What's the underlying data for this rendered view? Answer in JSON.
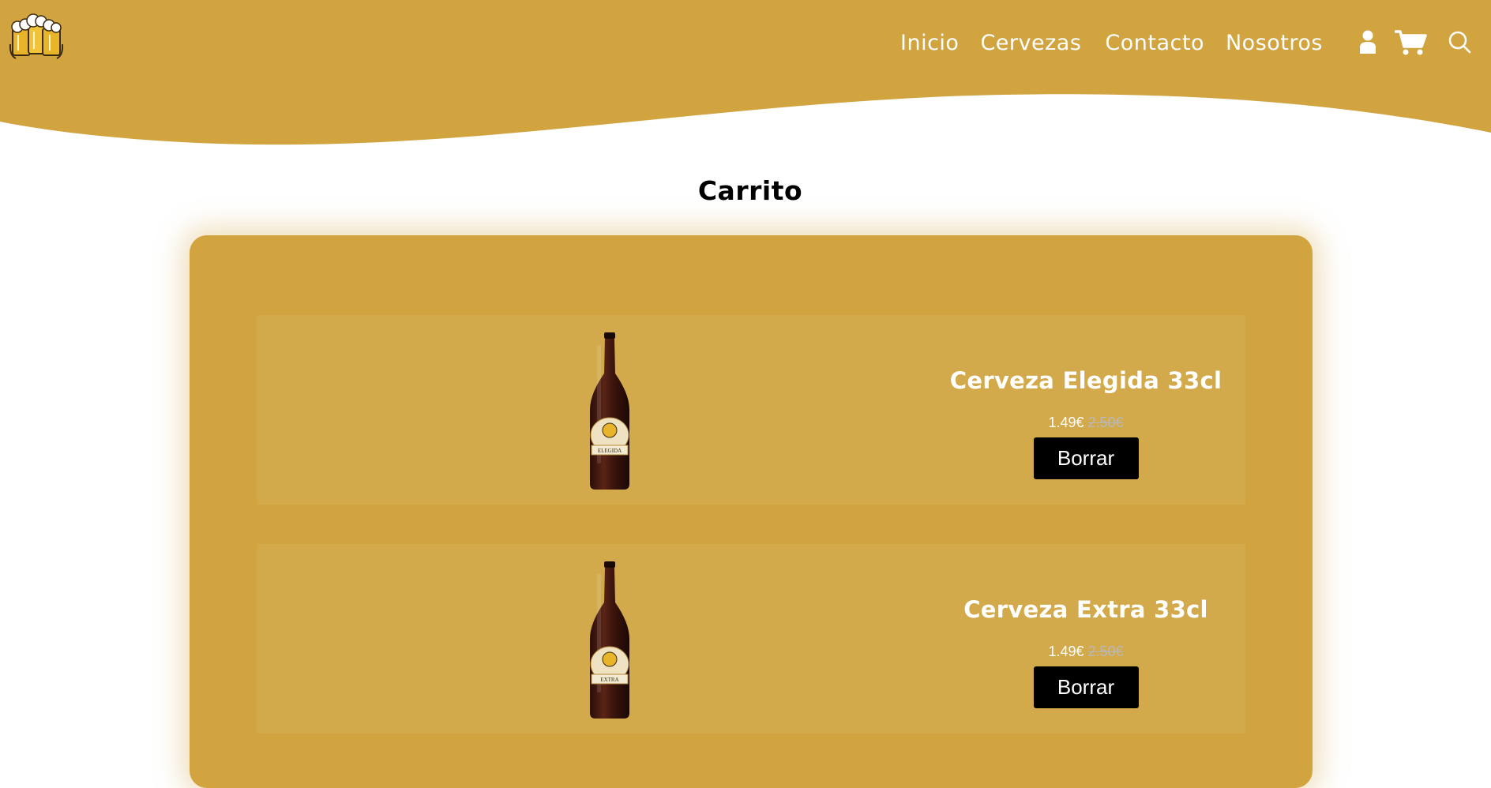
{
  "nav": {
    "links": [
      "Inicio",
      "Cervezas",
      "Contacto",
      "Nosotros"
    ]
  },
  "icons": {
    "logo": "beer-mugs-logo",
    "user": "user-icon",
    "cart": "cart-icon",
    "search": "search-icon"
  },
  "page": {
    "title": "Carrito"
  },
  "cart": {
    "items": [
      {
        "name": "Cerveza Elegida 33cl",
        "price": "1.49€",
        "old_price": "2.50€",
        "label_text": "ELEGIDA",
        "delete_label": "Borrar"
      },
      {
        "name": "Cerveza Extra 33cl",
        "price": "1.49€",
        "old_price": "2.50€",
        "label_text": "EXTRA",
        "delete_label": "Borrar"
      }
    ]
  },
  "colors": {
    "brand": "#d1a440",
    "item_bg": "#d3aa4b",
    "button": "#000000",
    "white": "#ffffff"
  }
}
